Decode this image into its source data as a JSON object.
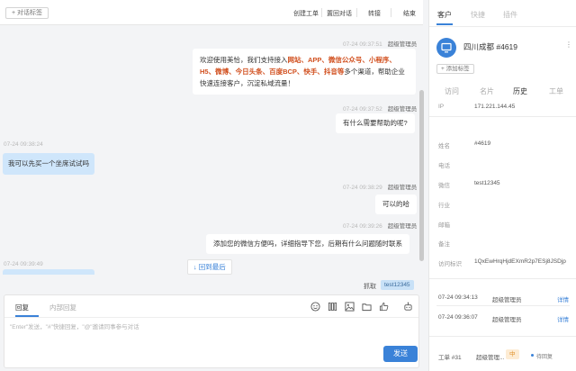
{
  "chat_header": {
    "tag_button": "+ 对话标签",
    "actions": [
      "创建工单",
      "置回对话",
      "转接",
      "结束"
    ]
  },
  "messages": [
    {
      "side": "right",
      "time": "07-24 09:37:51",
      "agent": "超级管理员",
      "segments": [
        {
          "t": "欢迎使用美恰，我们支持接入",
          "h": false
        },
        {
          "t": "网站、APP、微信公众号、小程序、H5、微博、今日头条、百度BCP、快手、抖音等",
          "h": true
        },
        {
          "t": "多个渠道，帮助企业快速连接客户，沉淀私域流量！",
          "h": false
        }
      ]
    },
    {
      "side": "right",
      "time": "07-24 09:37:52",
      "agent": "超级管理员",
      "text": "有什么需要帮助的呢?"
    },
    {
      "side": "left",
      "time": "07-24 09:38:24",
      "text": "我可以先买一个坐席试试吗"
    },
    {
      "side": "right",
      "time": "07-24 09:38:29",
      "agent": "超级管理员",
      "text": "可以的哈"
    },
    {
      "side": "right",
      "time": "07-24 09:39:26",
      "agent": "超级管理员",
      "text": "添加您的微信方便吗，详细指导下您，后期有什么问题随时联系"
    },
    {
      "side": "left",
      "time": "07-24 09:39:49",
      "text": ""
    }
  ],
  "back_to_latest": "回到最后",
  "capture": {
    "label": "抓取",
    "tag": "test12345"
  },
  "composer": {
    "tabs": [
      "回复",
      "内部回复"
    ],
    "placeholder": "\"Enter\"发送，\"#\"快捷回复，\"@\"邀请同事参与对话",
    "send_label": "发送"
  },
  "panel": {
    "tabs": [
      "客户",
      "快捷",
      "插件"
    ],
    "customer_name": "四川成都 #4619",
    "add_tag": "+ 添加标签",
    "sub_tabs": [
      "访问",
      "名片",
      "历史",
      "工单"
    ],
    "active_sub_tab": 2,
    "fields": [
      {
        "label": "IP",
        "value": "171.221.144.45"
      },
      {
        "label": "姓名",
        "value": "#4619"
      },
      {
        "label": "电话",
        "value": ""
      },
      {
        "label": "微信",
        "value": "test12345"
      },
      {
        "label": "行业",
        "value": ""
      },
      {
        "label": "邮箱",
        "value": ""
      },
      {
        "label": "备注",
        "value": ""
      },
      {
        "label": "访问标识",
        "value": "1QxEwHrqHjdEXmR2p7ESj8JSDjp"
      }
    ],
    "history": [
      {
        "time": "07-24 09:34:13",
        "who": "超级管理员",
        "link": "详情"
      },
      {
        "time": "07-24 09:36:07",
        "who": "超级管理员",
        "link": "详情"
      }
    ],
    "work_order": {
      "number": "工单 #31",
      "assignee": "超级管理...",
      "priority": "中",
      "status": "待回复"
    }
  },
  "colors": {
    "accent": "#3a82d8",
    "highlight": "#d14f1e",
    "customer_bubble": "#cfe6fb"
  }
}
